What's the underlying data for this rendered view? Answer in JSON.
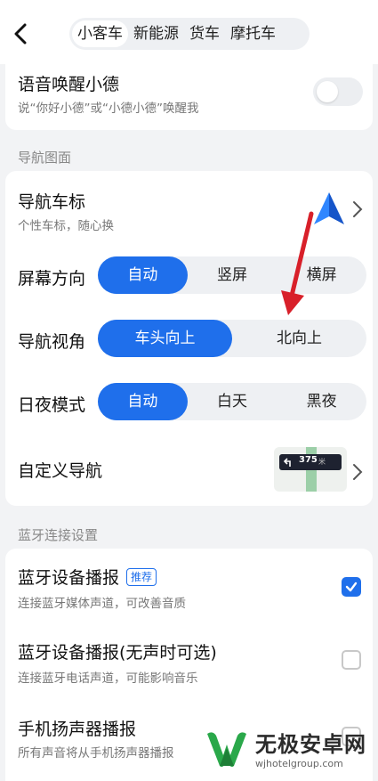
{
  "header": {
    "tabs": [
      {
        "label": "小客车",
        "active": true
      },
      {
        "label": "新能源",
        "active": false
      },
      {
        "label": "货车",
        "active": false
      },
      {
        "label": "摩托车",
        "active": false
      }
    ]
  },
  "voice": {
    "title": "语音唤醒小德",
    "subtitle": "说“你好小德”或“小德小德”唤醒我",
    "enabled": false
  },
  "nav_section": {
    "heading": "导航图面",
    "car_icon": {
      "title": "导航车标",
      "subtitle": "个性车标，随心换"
    },
    "screen_orientation": {
      "label": "屏幕方向",
      "options": [
        "自动",
        "竖屏",
        "横屏"
      ],
      "selected": 0
    },
    "view_angle": {
      "label": "导航视角",
      "options": [
        "车头向上",
        "北向上"
      ],
      "selected": 0
    },
    "day_night": {
      "label": "日夜模式",
      "options": [
        "自动",
        "白天",
        "黑夜"
      ],
      "selected": 0
    },
    "custom_nav": {
      "title": "自定义导航",
      "preview_text": "375",
      "preview_unit": "米"
    }
  },
  "bt_section": {
    "heading": "蓝牙连接设置",
    "items": [
      {
        "title": "蓝牙设备播报",
        "badge": "推荐",
        "subtitle": "连接蓝牙媒体声道，可改善音质",
        "checked": true
      },
      {
        "title": "蓝牙设备播报(无声时可选)",
        "subtitle": "连接蓝牙电话声道，可能影响音乐",
        "checked": false
      },
      {
        "title": "手机扬声器播报",
        "subtitle": "所有声音将从手机扬声器播报",
        "checked": false
      }
    ]
  },
  "watermark": {
    "title": "无极安卓网",
    "url": "wjhotelgroup.com"
  },
  "colors": {
    "accent": "#1f6feb",
    "arrow": "#d8202a",
    "background": "#f2f3f5"
  }
}
